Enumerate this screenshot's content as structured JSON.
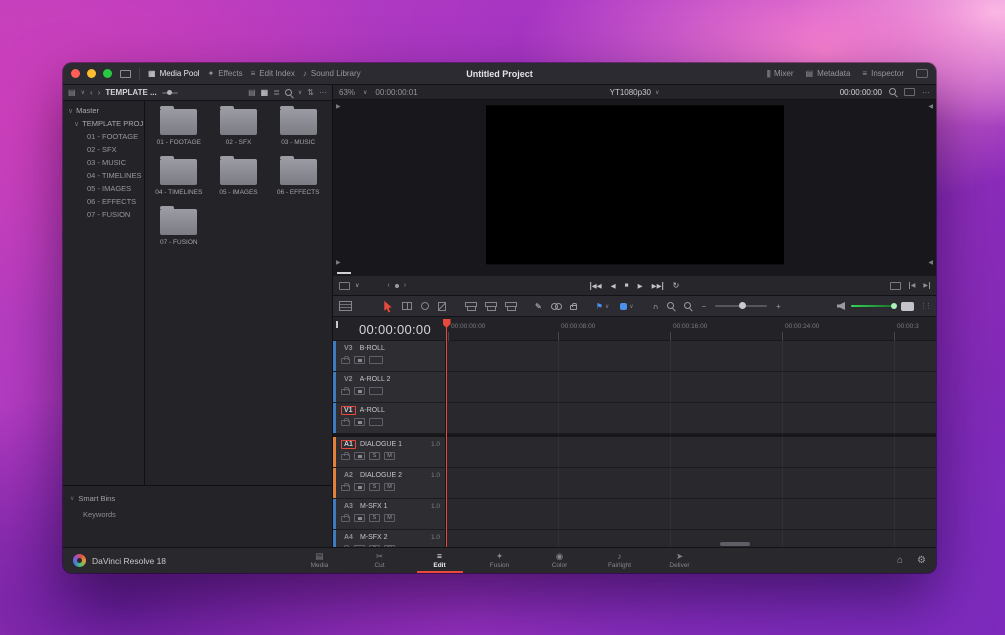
{
  "window": {
    "title": "Untitled Project"
  },
  "titlebar": {
    "media_pool": "Media Pool",
    "effects": "Effects",
    "edit_index": "Edit Index",
    "sound_library": "Sound Library",
    "mixer": "Mixer",
    "metadata": "Metadata",
    "inspector": "Inspector"
  },
  "media_pool": {
    "bin_label": "TEMPLATE ...",
    "tree_root": "Master",
    "tree_project": "TEMPLATE PROJ...",
    "tree_items": [
      "01 - FOOTAGE",
      "02 - SFX",
      "03 - MUSIC",
      "04 - TIMELINES",
      "05 - IMAGES",
      "06 - EFFECTS",
      "07 - FUSION"
    ],
    "folders": [
      "01 - FOOTAGE",
      "02 - SFX",
      "03 - MUSIC",
      "04 - TIMELINES",
      "05 - IMAGES",
      "06 - EFFECTS",
      "07 - FUSION"
    ],
    "smart_bins": "Smart Bins",
    "keywords": "Keywords"
  },
  "viewer": {
    "zoom": "63%",
    "in_timecode": "00:00:00:01",
    "timeline_name": "YT1080p30",
    "timecode": "00:00:00:00"
  },
  "timeline": {
    "timecode": "00:00:00:00",
    "ruler": [
      "00:00:00:00",
      "00:00:08:00",
      "00:00:16:00",
      "00:00:24:00",
      "00:00:3"
    ],
    "solo": "S",
    "mute": "M",
    "video_tracks": [
      {
        "id": "V3",
        "name": "B-ROLL"
      },
      {
        "id": "V2",
        "name": "A-ROLL 2"
      },
      {
        "id": "V1",
        "name": "A-ROLL"
      }
    ],
    "audio_tracks": [
      {
        "id": "A1",
        "name": "DIALOGUE 1",
        "level": "1.0"
      },
      {
        "id": "A2",
        "name": "DIALOGUE 2",
        "level": "1.0"
      },
      {
        "id": "A3",
        "name": "M-SFX 1",
        "level": "1.0"
      },
      {
        "id": "A4",
        "name": "M-SFX 2",
        "level": "1.0"
      }
    ]
  },
  "pages": {
    "app_name": "DaVinci Resolve 18",
    "items": [
      "Media",
      "Cut",
      "Edit",
      "Fusion",
      "Color",
      "Fairlight",
      "Deliver"
    ],
    "active": "Edit"
  },
  "icons": {
    "chevron_down": "∨",
    "chevron_left": "‹",
    "chevron_right": "›",
    "dots": "···",
    "dots_v": "⋮⋮",
    "grid_view": "▦",
    "list_view": "≣",
    "strip_view": "▤",
    "sort": "⇅",
    "media_pool": "▦",
    "effects": "✦",
    "edit_index": "≡",
    "sound_library": "♪",
    "mixer": "|||",
    "metadata": "▤",
    "inspector": "≡",
    "skip_start": "◀◀",
    "step_back": "◀",
    "stop": "■",
    "play": "▶",
    "skip_end": "▶▶",
    "loop": "↻",
    "prev_edit": "◀",
    "next_edit": "▶",
    "pen": "✎",
    "flag": "⚑",
    "snap": "∩",
    "minus": "−",
    "plus": "+",
    "home": "⌂",
    "gear": "⚙",
    "page_media": "▤",
    "page_cut": "✂",
    "page_edit": "≡",
    "page_fusion": "✦",
    "page_color": "◉",
    "page_fairlight": "♪",
    "page_deliver": "➤"
  },
  "colors": {
    "accent_red": "#e8493c",
    "video_track_strip": "#3e7cc1",
    "dialogue_track_strip": "#e0823c",
    "flag_blue": "#4a8fe8",
    "meter_green": "#34d653"
  }
}
